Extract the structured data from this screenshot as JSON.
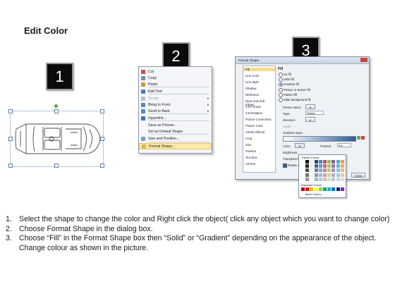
{
  "page_title": "Edit Color",
  "step_badges": [
    "1",
    "2",
    "3"
  ],
  "context_menu": {
    "items": [
      {
        "label": "Cut",
        "arrow": false,
        "icon_color": "#d24a4a",
        "disabled": false
      },
      {
        "label": "Copy",
        "arrow": false,
        "icon_color": "#6e8db8",
        "disabled": false
      },
      {
        "label": "Paste",
        "arrow": false,
        "icon_color": "#c89a3c",
        "disabled": false
      },
      {
        "label": "Edit Text",
        "arrow": false,
        "icon_color": "#4f78b6",
        "disabled": false
      },
      {
        "label": "Group",
        "arrow": true,
        "icon_color": "#b9bec6",
        "disabled": true
      },
      {
        "label": "Bring to Front",
        "arrow": true,
        "icon_color": "#5b86c4",
        "disabled": false
      },
      {
        "label": "Send to Back",
        "arrow": true,
        "icon_color": "#5b86c4",
        "disabled": false
      },
      {
        "label": "Hyperlink...",
        "arrow": false,
        "icon_color": "#3a74c9",
        "disabled": false
      },
      {
        "label": "Save as Picture...",
        "arrow": false,
        "icon_color": "",
        "disabled": false
      },
      {
        "label": "Set as Default Shape",
        "arrow": false,
        "icon_color": "",
        "disabled": false
      },
      {
        "label": "Size and Position...",
        "arrow": false,
        "icon_color": "#7c9cc6",
        "disabled": false
      },
      {
        "label": "Format Shape...",
        "arrow": false,
        "icon_color": "#e3b540",
        "disabled": false
      }
    ]
  },
  "format_dialog": {
    "title": "Format Shape",
    "nav_items": [
      "Fill",
      "Line Color",
      "Line Style",
      "Shadow",
      "Reflection",
      "Glow and Soft Edges",
      "3-D Format",
      "3-D Rotation",
      "Picture Corrections",
      "Picture Color",
      "Artistic Effects",
      "Crop",
      "Size",
      "Position",
      "Text Box",
      "Alt Text"
    ],
    "section": "Fill",
    "fill_options": [
      "No fill",
      "Solid fill",
      "Gradient fill",
      "Picture or texture fill",
      "Pattern fill",
      "Slide background fill"
    ],
    "selected_fill": "Gradient fill",
    "preset_colors_label": "Preset colors:",
    "type_label": "Type:",
    "type_value": "Radial",
    "direction_label": "Direction:",
    "angle_label": "Angle:",
    "gradient_stops_label": "Gradient stops",
    "color_label": "Color",
    "position_label": "Position:",
    "position_value": "0%",
    "brightness_label": "Brightness:",
    "transparency_label": "Transparency:",
    "rotate_label": "Rotate with shape",
    "palette_theme_label": "Theme Colors",
    "palette_standard_label": "Standard Colors",
    "palette_more_label": "More Colors...",
    "close_label": "Close"
  },
  "instructions": [
    {
      "num": "1.",
      "text": "Select the shape to change the color and Right click the object( click any object which you want to change color)"
    },
    {
      "num": "2.",
      "text": "Choose Format Shape in the dialog box."
    },
    {
      "num": "3.",
      "text": "Choose “Fill” in the Format Shape box then “Solid” or “Gradient” depending on the appearance of the object. Change colour as shown in the picture."
    }
  ]
}
